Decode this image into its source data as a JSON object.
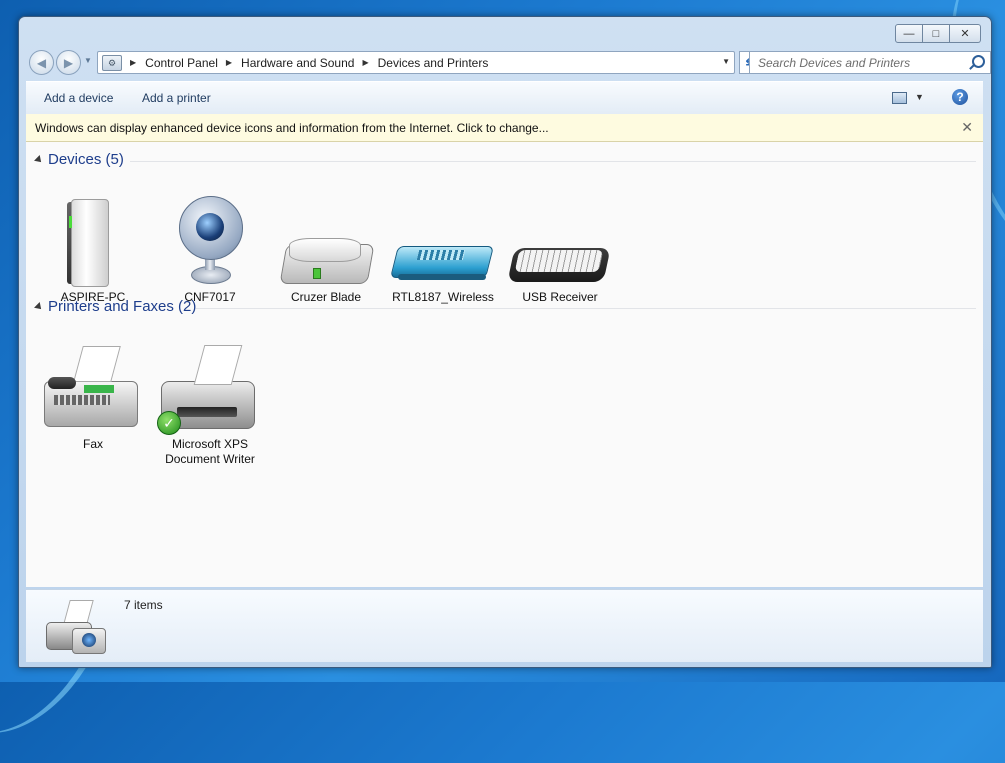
{
  "window": {
    "controls": {
      "minimize": "—",
      "maximize": "□",
      "close": "✕"
    }
  },
  "nav": {
    "breadcrumbs": [
      "Control Panel",
      "Hardware and Sound",
      "Devices and Printers"
    ],
    "search_placeholder": "Search Devices and Printers"
  },
  "toolbar": {
    "add_device": "Add a device",
    "add_printer": "Add a printer"
  },
  "infobar": {
    "message": "Windows can display enhanced device icons and information from the Internet. Click to change..."
  },
  "groups": {
    "devices": {
      "title": "Devices (5)",
      "items": [
        {
          "label": "ASPIRE-PC",
          "icon": "computer-icon"
        },
        {
          "label": "CNF7017",
          "icon": "webcam-icon"
        },
        {
          "label": "Cruzer Blade",
          "icon": "drive-icon"
        },
        {
          "label": "RTL8187_Wireless",
          "icon": "network-adapter-icon"
        },
        {
          "label": "USB Receiver",
          "icon": "keyboard-icon"
        }
      ]
    },
    "printers": {
      "title": "Printers and Faxes (2)",
      "items": [
        {
          "label": "Fax",
          "icon": "fax-icon"
        },
        {
          "label_line1": "Microsoft XPS",
          "label_line2": "Document Writer",
          "icon": "printer-icon",
          "default": true
        }
      ]
    }
  },
  "details": {
    "count": "7 items"
  }
}
